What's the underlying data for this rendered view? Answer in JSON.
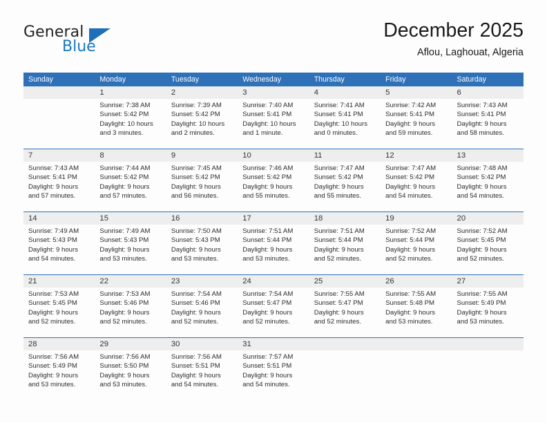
{
  "brand": {
    "name_top": "General",
    "name_bottom": "Blue",
    "triangle_color": "#1e6fb8",
    "text_color": "#231f20",
    "blue_color": "#1878be"
  },
  "header": {
    "title": "December 2025",
    "subtitle": "Aflou, Laghouat, Algeria"
  },
  "colors": {
    "header_bar": "#2e71b8",
    "row_band": "#eeeeee",
    "row_divider": "#2e71b8",
    "page_bg": "#fdfdfd"
  },
  "weekday_headers": [
    "Sunday",
    "Monday",
    "Tuesday",
    "Wednesday",
    "Thursday",
    "Friday",
    "Saturday"
  ],
  "weeks": [
    [
      {
        "day": "",
        "info": ""
      },
      {
        "day": "1",
        "info": "Sunrise: 7:38 AM\nSunset: 5:42 PM\nDaylight: 10 hours\nand 3 minutes."
      },
      {
        "day": "2",
        "info": "Sunrise: 7:39 AM\nSunset: 5:42 PM\nDaylight: 10 hours\nand 2 minutes."
      },
      {
        "day": "3",
        "info": "Sunrise: 7:40 AM\nSunset: 5:41 PM\nDaylight: 10 hours\nand 1 minute."
      },
      {
        "day": "4",
        "info": "Sunrise: 7:41 AM\nSunset: 5:41 PM\nDaylight: 10 hours\nand 0 minutes."
      },
      {
        "day": "5",
        "info": "Sunrise: 7:42 AM\nSunset: 5:41 PM\nDaylight: 9 hours\nand 59 minutes."
      },
      {
        "day": "6",
        "info": "Sunrise: 7:43 AM\nSunset: 5:41 PM\nDaylight: 9 hours\nand 58 minutes."
      }
    ],
    [
      {
        "day": "7",
        "info": "Sunrise: 7:43 AM\nSunset: 5:41 PM\nDaylight: 9 hours\nand 57 minutes."
      },
      {
        "day": "8",
        "info": "Sunrise: 7:44 AM\nSunset: 5:42 PM\nDaylight: 9 hours\nand 57 minutes."
      },
      {
        "day": "9",
        "info": "Sunrise: 7:45 AM\nSunset: 5:42 PM\nDaylight: 9 hours\nand 56 minutes."
      },
      {
        "day": "10",
        "info": "Sunrise: 7:46 AM\nSunset: 5:42 PM\nDaylight: 9 hours\nand 55 minutes."
      },
      {
        "day": "11",
        "info": "Sunrise: 7:47 AM\nSunset: 5:42 PM\nDaylight: 9 hours\nand 55 minutes."
      },
      {
        "day": "12",
        "info": "Sunrise: 7:47 AM\nSunset: 5:42 PM\nDaylight: 9 hours\nand 54 minutes."
      },
      {
        "day": "13",
        "info": "Sunrise: 7:48 AM\nSunset: 5:42 PM\nDaylight: 9 hours\nand 54 minutes."
      }
    ],
    [
      {
        "day": "14",
        "info": "Sunrise: 7:49 AM\nSunset: 5:43 PM\nDaylight: 9 hours\nand 54 minutes."
      },
      {
        "day": "15",
        "info": "Sunrise: 7:49 AM\nSunset: 5:43 PM\nDaylight: 9 hours\nand 53 minutes."
      },
      {
        "day": "16",
        "info": "Sunrise: 7:50 AM\nSunset: 5:43 PM\nDaylight: 9 hours\nand 53 minutes."
      },
      {
        "day": "17",
        "info": "Sunrise: 7:51 AM\nSunset: 5:44 PM\nDaylight: 9 hours\nand 53 minutes."
      },
      {
        "day": "18",
        "info": "Sunrise: 7:51 AM\nSunset: 5:44 PM\nDaylight: 9 hours\nand 52 minutes."
      },
      {
        "day": "19",
        "info": "Sunrise: 7:52 AM\nSunset: 5:44 PM\nDaylight: 9 hours\nand 52 minutes."
      },
      {
        "day": "20",
        "info": "Sunrise: 7:52 AM\nSunset: 5:45 PM\nDaylight: 9 hours\nand 52 minutes."
      }
    ],
    [
      {
        "day": "21",
        "info": "Sunrise: 7:53 AM\nSunset: 5:45 PM\nDaylight: 9 hours\nand 52 minutes."
      },
      {
        "day": "22",
        "info": "Sunrise: 7:53 AM\nSunset: 5:46 PM\nDaylight: 9 hours\nand 52 minutes."
      },
      {
        "day": "23",
        "info": "Sunrise: 7:54 AM\nSunset: 5:46 PM\nDaylight: 9 hours\nand 52 minutes."
      },
      {
        "day": "24",
        "info": "Sunrise: 7:54 AM\nSunset: 5:47 PM\nDaylight: 9 hours\nand 52 minutes."
      },
      {
        "day": "25",
        "info": "Sunrise: 7:55 AM\nSunset: 5:47 PM\nDaylight: 9 hours\nand 52 minutes."
      },
      {
        "day": "26",
        "info": "Sunrise: 7:55 AM\nSunset: 5:48 PM\nDaylight: 9 hours\nand 53 minutes."
      },
      {
        "day": "27",
        "info": "Sunrise: 7:55 AM\nSunset: 5:49 PM\nDaylight: 9 hours\nand 53 minutes."
      }
    ],
    [
      {
        "day": "28",
        "info": "Sunrise: 7:56 AM\nSunset: 5:49 PM\nDaylight: 9 hours\nand 53 minutes."
      },
      {
        "day": "29",
        "info": "Sunrise: 7:56 AM\nSunset: 5:50 PM\nDaylight: 9 hours\nand 53 minutes."
      },
      {
        "day": "30",
        "info": "Sunrise: 7:56 AM\nSunset: 5:51 PM\nDaylight: 9 hours\nand 54 minutes."
      },
      {
        "day": "31",
        "info": "Sunrise: 7:57 AM\nSunset: 5:51 PM\nDaylight: 9 hours\nand 54 minutes."
      },
      {
        "day": "",
        "info": ""
      },
      {
        "day": "",
        "info": ""
      },
      {
        "day": "",
        "info": ""
      }
    ]
  ]
}
